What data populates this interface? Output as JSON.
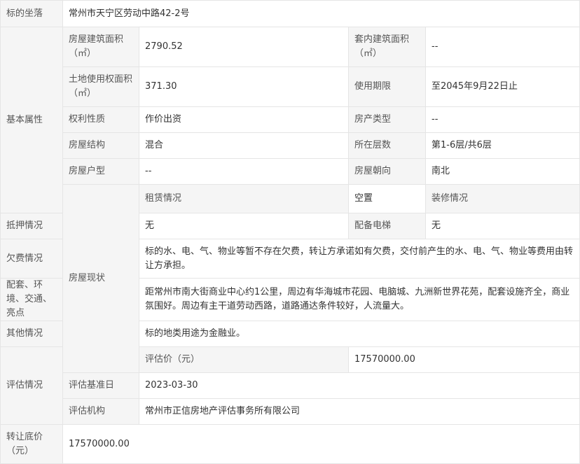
{
  "location": {
    "label": "标的坐落",
    "value": "常州市天宁区劳动中路42-2号"
  },
  "basic": {
    "section": "基本属性",
    "building_area_label": "房屋建筑面积（㎡）",
    "building_area": "2790.52",
    "inner_area_label": "套内建筑面积（㎡）",
    "inner_area": "--",
    "land_area_label": "土地使用权面积（㎡）",
    "land_area": "371.30",
    "use_term_label": "使用期限",
    "use_term": "至2045年9月22日止",
    "right_nature_label": "权利性质",
    "right_nature": "作价出资",
    "property_type_label": "房产类型",
    "property_type": "--",
    "structure_label": "房屋结构",
    "structure": "混合",
    "floor_label": "所在层数",
    "floor": "第1-6层/共6层",
    "house_type_label": "房屋户型",
    "house_type": "--",
    "orientation_label": "房屋朝向",
    "orientation": "南北"
  },
  "status": {
    "section": "房屋现状",
    "lease_label": "租赁情况",
    "lease": "空置",
    "decoration_label": "装修情况",
    "decoration": "--",
    "mortgage_label": "抵押情况",
    "mortgage": "无",
    "elevator_label": "配备电梯",
    "elevator": "无",
    "arrears_label": "欠费情况",
    "arrears": "标的水、电、气、物业等暂不存在欠费，转让方承诺如有欠费，交付前产生的水、电、气、物业等费用由转让方承担。",
    "facilities_label": "配套、环境、交通、亮点",
    "facilities": "距常州市南大街商业中心约1公里，周边有华海城市花园、电脑城、九洲新世界花苑，配套设施齐全，商业氛围好。周边有主干道劳动西路，道路通达条件较好，人流量大。",
    "other_label": "其他情况",
    "other": "标的地类用途为金融业。"
  },
  "valuation": {
    "section": "评估情况",
    "price_label": "评估价（元）",
    "price": "17570000.00",
    "base_date_label": "评估基准日",
    "base_date": "2023-03-30",
    "agency_label": "评估机构",
    "agency": "常州市正信房地产评估事务所有限公司"
  },
  "reserve": {
    "label": "转让底价（元）",
    "value": "17570000.00"
  }
}
